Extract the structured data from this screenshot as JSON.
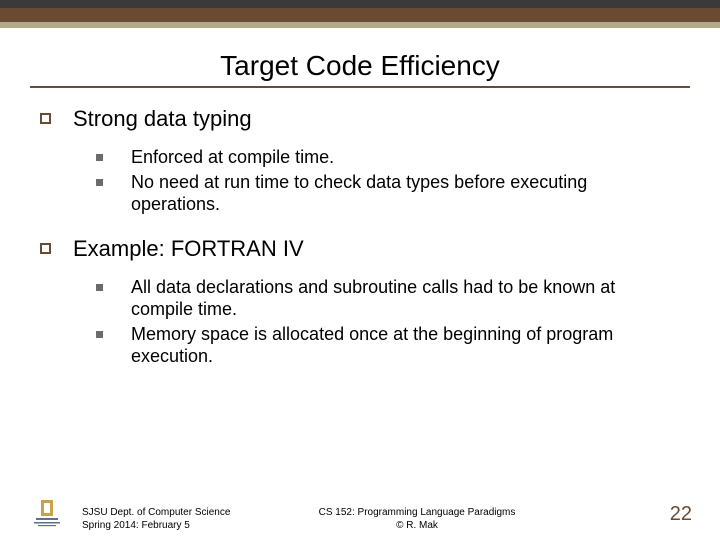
{
  "title": "Target Code Efficiency",
  "section1": {
    "heading": "Strong data typing",
    "items": [
      "Enforced at compile time.",
      "No need at run time to check data types before executing operations."
    ]
  },
  "section2": {
    "heading": "Example: FORTRAN IV",
    "items": [
      "All data declarations and subroutine calls had to be known at compile time.",
      "Memory space is allocated once at the beginning of program execution."
    ]
  },
  "footer": {
    "left_line1": "SJSU Dept. of Computer Science",
    "left_line2": "Spring 2014: February 5",
    "mid_line1": "CS 152: Programming Language Paradigms",
    "mid_line2": "© R. Mak"
  },
  "page_number": "22"
}
